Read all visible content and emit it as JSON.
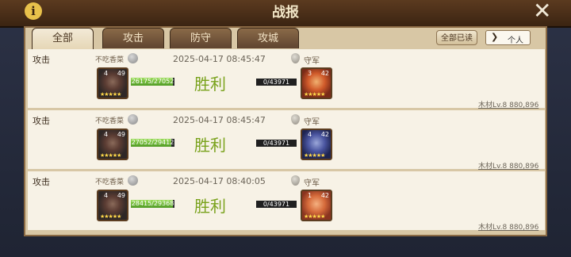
{
  "header": {
    "title": "战报"
  },
  "tabs": [
    {
      "label": "全部",
      "active": true
    },
    {
      "label": "攻击",
      "active": false
    },
    {
      "label": "防守",
      "active": false
    },
    {
      "label": "攻城",
      "active": false
    }
  ],
  "actions": {
    "read_all_label": "全部已读",
    "filter_label": "个人"
  },
  "reports": [
    {
      "type": "攻击",
      "attacker": "不吃香菜",
      "time": "2025-04-17 08:45:47",
      "defender": "守军",
      "attacker_level": "4",
      "attacker_lv": "49",
      "attacker_hp": "26175/27052",
      "attacker_hp_fraction": 0.97,
      "result": "胜利",
      "defender_hp": "0/43971",
      "defender_level": "3",
      "defender_lv": "42",
      "loot": "木材Lv.8 880,896"
    },
    {
      "type": "攻击",
      "attacker": "不吃香菜",
      "time": "2025-04-17 08:45:47",
      "defender": "守军",
      "attacker_level": "4",
      "attacker_lv": "49",
      "attacker_hp": "27052/29412",
      "attacker_hp_fraction": 0.92,
      "result": "胜利",
      "defender_hp": "0/43971",
      "defender_level": "4",
      "defender_lv": "42",
      "loot": "木材Lv.8 880,896"
    },
    {
      "type": "攻击",
      "attacker": "不吃香菜",
      "time": "2025-04-17 08:40:05",
      "defender": "守军",
      "attacker_level": "4",
      "attacker_lv": "49",
      "attacker_hp": "28415/29368",
      "attacker_hp_fraction": 0.97,
      "result": "胜利",
      "defender_hp": "0/43971",
      "defender_level": "1",
      "defender_lv": "42",
      "loot": "木材Lv.8 880,896"
    }
  ],
  "stars": "★★★★★"
}
